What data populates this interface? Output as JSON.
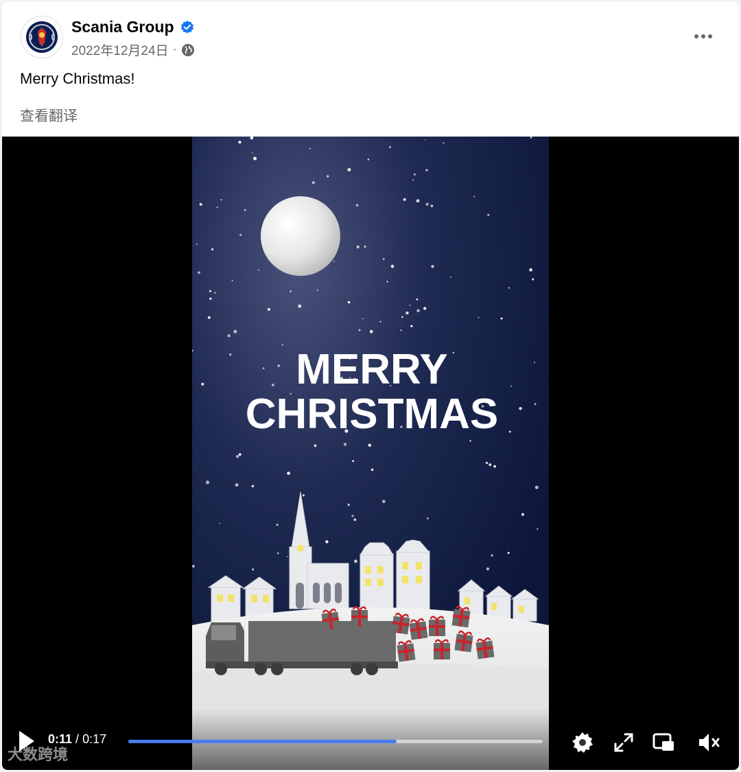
{
  "post": {
    "author": "Scania Group",
    "date": "2022年12月24日",
    "separator": "·",
    "text": "Merry Christmas!",
    "translate_label": "查看翻译"
  },
  "video": {
    "overlay_title_line1": "MERRY",
    "overlay_title_line2": "CHRISTMAS",
    "current_time": "0:11",
    "time_separator": " / ",
    "duration": "0:17",
    "progress_fraction": 0.647,
    "icons": [
      "play-icon",
      "settings-icon",
      "fullscreen-icon",
      "picture-in-picture-icon",
      "muted-speaker-icon"
    ]
  },
  "watermark": {
    "text": "大数跨境"
  },
  "colors": {
    "verified": "#1877f2",
    "progress_fill": "#4a7cf0",
    "night_sky": "#0e1a3b",
    "gift_ribbon": "#c8242d"
  }
}
